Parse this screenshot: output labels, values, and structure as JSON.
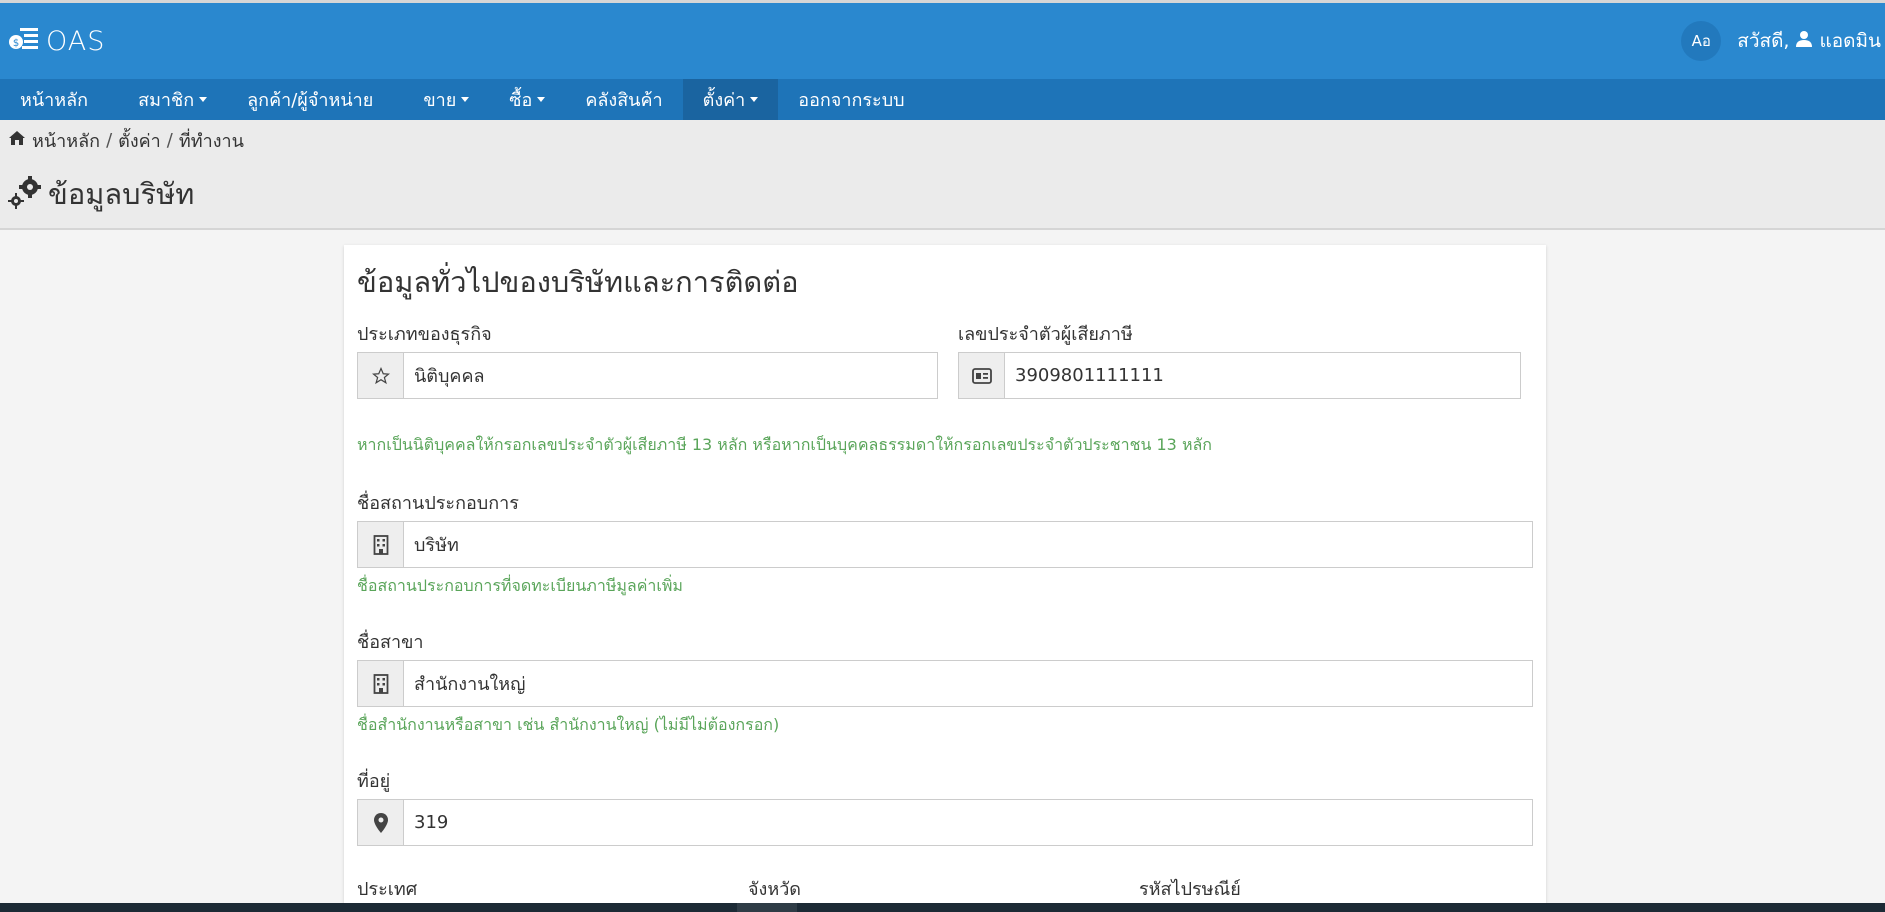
{
  "app": {
    "title": "OAS"
  },
  "header": {
    "lang_label": "Aอ",
    "greeting": "สวัสดี,",
    "user_name": "แอดมิน"
  },
  "nav": {
    "home": "หน้าหลัก",
    "members": "สมาชิก",
    "customers": "ลูกค้า/ผู้จำหน่าย",
    "sales": "ขาย",
    "purchase": "ซื้อ",
    "inventory": "คลังสินค้า",
    "settings": "ตั้งค่า",
    "logout": "ออกจากระบบ"
  },
  "breadcrumb": {
    "home": "หน้าหลัก",
    "settings": "ตั้งค่า",
    "current": "ที่ทำงาน"
  },
  "page": {
    "title": "ข้อมูลบริษัท"
  },
  "form": {
    "section_title": "ข้อมูลทั่วไปของบริษัทและการติดต่อ",
    "business_type": {
      "label": "ประเภทของธุรกิจ",
      "value": "นิติบุคคล"
    },
    "tax_id": {
      "label": "เลขประจำตัวผู้เสียภาษี",
      "value": "3909801111111"
    },
    "tax_help": "หากเป็นนิติบุคคลให้กรอกเลขประจำตัวผู้เสียภาษี 13 หลัก หรือหากเป็นบุคคลธรรมดาให้กรอกเลขประจำตัวประชาชน 13 หลัก",
    "company_name": {
      "label": "ชื่อสถานประกอบการ",
      "value": "บริษัท",
      "help": "ชื่อสถานประกอบการที่จดทะเบียนภาษีมูลค่าเพิ่ม"
    },
    "branch_name": {
      "label": "ชื่อสาขา",
      "value": "สำนักงานใหญ่",
      "help": "ชื่อสำนักงานหรือสาขา เช่น สำนักงานใหญ่ (ไม่มีไม่ต้องกรอก)"
    },
    "address": {
      "label": "ที่อยู่",
      "value": "319"
    },
    "country": {
      "label": "ประเทศ"
    },
    "province": {
      "label": "จังหวัด"
    },
    "postal_code": {
      "label": "รหัสไปรษณีย์"
    }
  },
  "colors": {
    "header": "#2a88cf",
    "navbar": "#1e74b8",
    "help_text": "#5aa55a"
  }
}
